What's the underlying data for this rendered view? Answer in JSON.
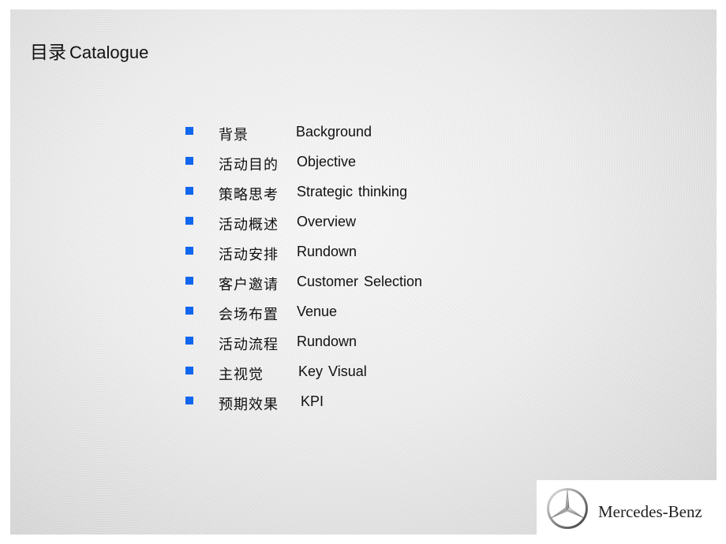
{
  "slide": {
    "title_cn": "目录",
    "title_en": "Catalogue"
  },
  "toc": {
    "bullet_color": "#1166ee",
    "items": [
      {
        "cn": "背景",
        "en": "Background"
      },
      {
        "cn": "活动目的",
        "en": "Objective"
      },
      {
        "cn": "策略思考",
        "en": "Strategic thinking"
      },
      {
        "cn": "活动概述",
        "en": "Overview"
      },
      {
        "cn": "活动安排",
        "en": "Rundown"
      },
      {
        "cn": "客户邀请",
        "en": "Customer Selection"
      },
      {
        "cn": "会场布置",
        "en": "Venue"
      },
      {
        "cn": "活动流程",
        "en": "Rundown"
      },
      {
        "cn": "主视觉",
        "en": "Key Visual"
      },
      {
        "cn": "预期效果",
        "en": "KPI"
      }
    ]
  },
  "logo": {
    "icon": "three-pointed-star-icon",
    "brand": "Mercedes-Benz"
  }
}
